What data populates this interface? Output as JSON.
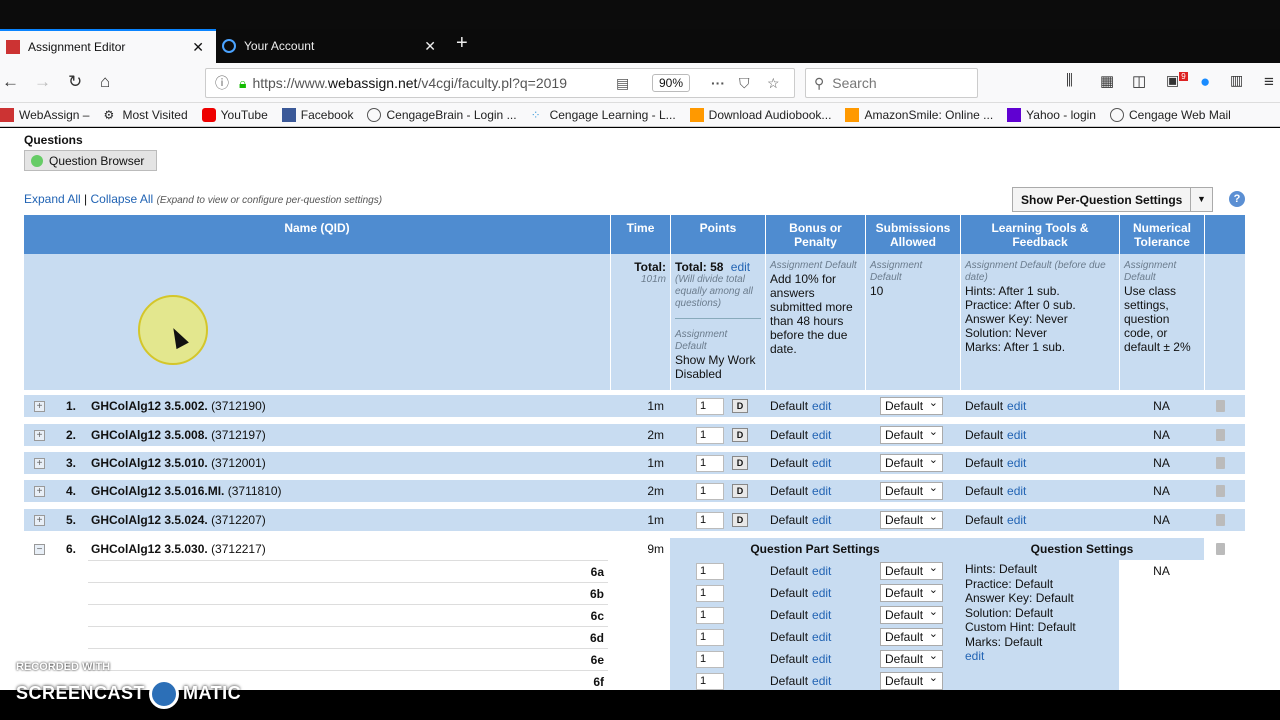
{
  "browser": {
    "tabs": [
      {
        "label": "Assignment Editor"
      },
      {
        "label": "Your Account"
      }
    ],
    "url_prefix": "https://www.",
    "url_domain": "webassign.net",
    "url_rest": "/v4cgi/faculty.pl?q=2019",
    "zoom": "90%",
    "search_placeholder": "Search",
    "badge": "9",
    "bookmarks": [
      "WebAssign –",
      "Most Visited",
      "YouTube",
      "Facebook",
      "CengageBrain - Login ...",
      "Cengage Learning - L...",
      "Download Audiobook...",
      "AmazonSmile: Online ...",
      "Yahoo - login",
      "Cengage Web Mail"
    ]
  },
  "page": {
    "section_title": "Questions",
    "question_browser": "Question Browser",
    "expand_all": "Expand All",
    "collapse_all": "Collapse All",
    "expand_note": "(Expand to view or configure per-question settings)",
    "show_per_question": "Show Per-Question Settings",
    "help": "?"
  },
  "table": {
    "headers": {
      "name": "Name (QID)",
      "time": "Time",
      "points": "Points",
      "bonus": "Bonus or Penalty",
      "submissions": "Submissions Allowed",
      "tools": "Learning Tools & Feedback",
      "numerical": "Numerical Tolerance"
    },
    "defaults": {
      "total_label": "Total:",
      "total_time": "101m",
      "points_total": "Total: 58",
      "points_edit": "edit",
      "points_note": "(Will divide total equally among all questions)",
      "assignment_default": "Assignment Default",
      "show_my_work": "Show My Work Disabled",
      "bonus_label": "Assignment Default",
      "bonus_text": "Add 10% for answers submitted more than 48 hours before the due date.",
      "subs_label": "Assignment Default",
      "subs_value": "10",
      "tools_label": "Assignment Default (before due date)",
      "tools_text": "Hints: After 1 sub.\nPractice: After 0 sub.\nAnswer Key: Never\nSolution: Never\nMarks: After 1 sub.",
      "num_label": "Assignment Default",
      "num_text": "Use class settings, question code, or default ± 2%"
    },
    "rows": [
      {
        "num": "1.",
        "name": "GHColAlg12 3.5.002.",
        "qid": "(3712190)",
        "time": "1m",
        "points": "1",
        "bonus": "Default",
        "sub": "Default",
        "tools": "Default",
        "num_tol": "NA"
      },
      {
        "num": "2.",
        "name": "GHColAlg12 3.5.008.",
        "qid": "(3712197)",
        "time": "2m",
        "points": "1",
        "bonus": "Default",
        "sub": "Default",
        "tools": "Default",
        "num_tol": "NA"
      },
      {
        "num": "3.",
        "name": "GHColAlg12 3.5.010.",
        "qid": "(3712001)",
        "time": "1m",
        "points": "1",
        "bonus": "Default",
        "sub": "Default",
        "tools": "Default",
        "num_tol": "NA"
      },
      {
        "num": "4.",
        "name": "GHColAlg12 3.5.016.MI.",
        "qid": "(3711810)",
        "time": "2m",
        "points": "1",
        "bonus": "Default",
        "sub": "Default",
        "tools": "Default",
        "num_tol": "NA"
      },
      {
        "num": "5.",
        "name": "GHColAlg12 3.5.024.",
        "qid": "(3712207)",
        "time": "1m",
        "points": "1",
        "bonus": "Default",
        "sub": "Default",
        "tools": "Default",
        "num_tol": "NA"
      }
    ],
    "edit": "edit",
    "d_button": "D",
    "q6": {
      "num": "6.",
      "name": "GHColAlg12 3.5.030.",
      "qid": "(3712217)",
      "time": "9m",
      "part_settings": "Question Part Settings",
      "q_settings": "Question Settings",
      "num_tol": "NA",
      "settings_text": "Hints: Default\nPractice: Default\nAnswer Key: Default\nSolution: Default\nCustom Hint: Default\nMarks: Default",
      "settings_edit": "edit",
      "parts": [
        {
          "label": "6a",
          "points": "1",
          "bonus": "Default",
          "sub": "Default"
        },
        {
          "label": "6b",
          "points": "1",
          "bonus": "Default",
          "sub": "Default"
        },
        {
          "label": "6c",
          "points": "1",
          "bonus": "Default",
          "sub": "Default"
        },
        {
          "label": "6d",
          "points": "1",
          "bonus": "Default",
          "sub": "Default"
        },
        {
          "label": "6e",
          "points": "1",
          "bonus": "Default",
          "sub": "Default"
        },
        {
          "label": "6f",
          "points": "1",
          "bonus": "Default",
          "sub": "Default"
        }
      ]
    }
  },
  "watermark": {
    "line1": "RECORDED WITH",
    "line2a": "SCREENCAST",
    "line2b": "MATIC"
  }
}
